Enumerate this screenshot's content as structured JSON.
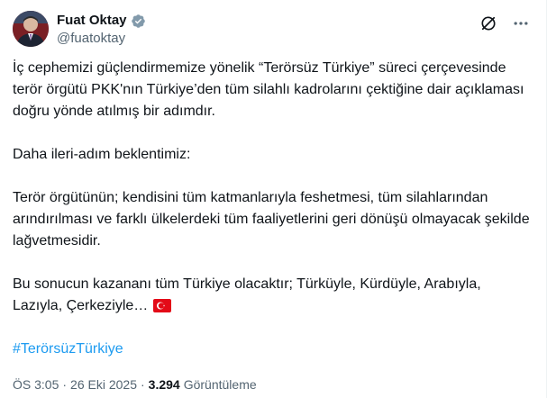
{
  "author": {
    "name": "Fuat Oktay",
    "handle": "@fuatoktay"
  },
  "tweet": {
    "p1": "İç cephemizi güçlendirmemize yönelik “Terörsüz Türkiye” süreci çerçevesinde terör örgütü PKK'nın Türkiye’den tüm silahlı kadrolarını çektiğine dair açıklaması doğru yönde atılmış bir adımdır.",
    "p2": "Daha ileri-adım beklentimiz:",
    "p3": "Terör örgütünün; kendisini tüm katmanlarıyla feshetmesi, tüm silahlarından arındırılması ve farklı ülkelerdeki tüm faaliyetlerini geri dönüşü olmayacak şekilde lağvetmesidir.",
    "p4": "Bu sonucun kazananı tüm Türkiye olacaktır; Türküyle, Kürdüyle, Arabıyla, Lazıyla, Çerkeziyle…",
    "hashtag": "#TerörsüzTürkiye"
  },
  "meta": {
    "time": "ÖS 3:05",
    "separator": "·",
    "date": "26 Eki 2025",
    "views_count": "3.294",
    "views_label": "Görüntüleme"
  },
  "colors": {
    "verified": "#829aab",
    "link": "#1d9bf0",
    "muted": "#536471",
    "flag_red": "#e30a17"
  },
  "icons": {
    "verified": "verified-badge-icon",
    "grok": "grok-icon",
    "more": "more-icon",
    "flag": "turkey-flag-icon"
  }
}
